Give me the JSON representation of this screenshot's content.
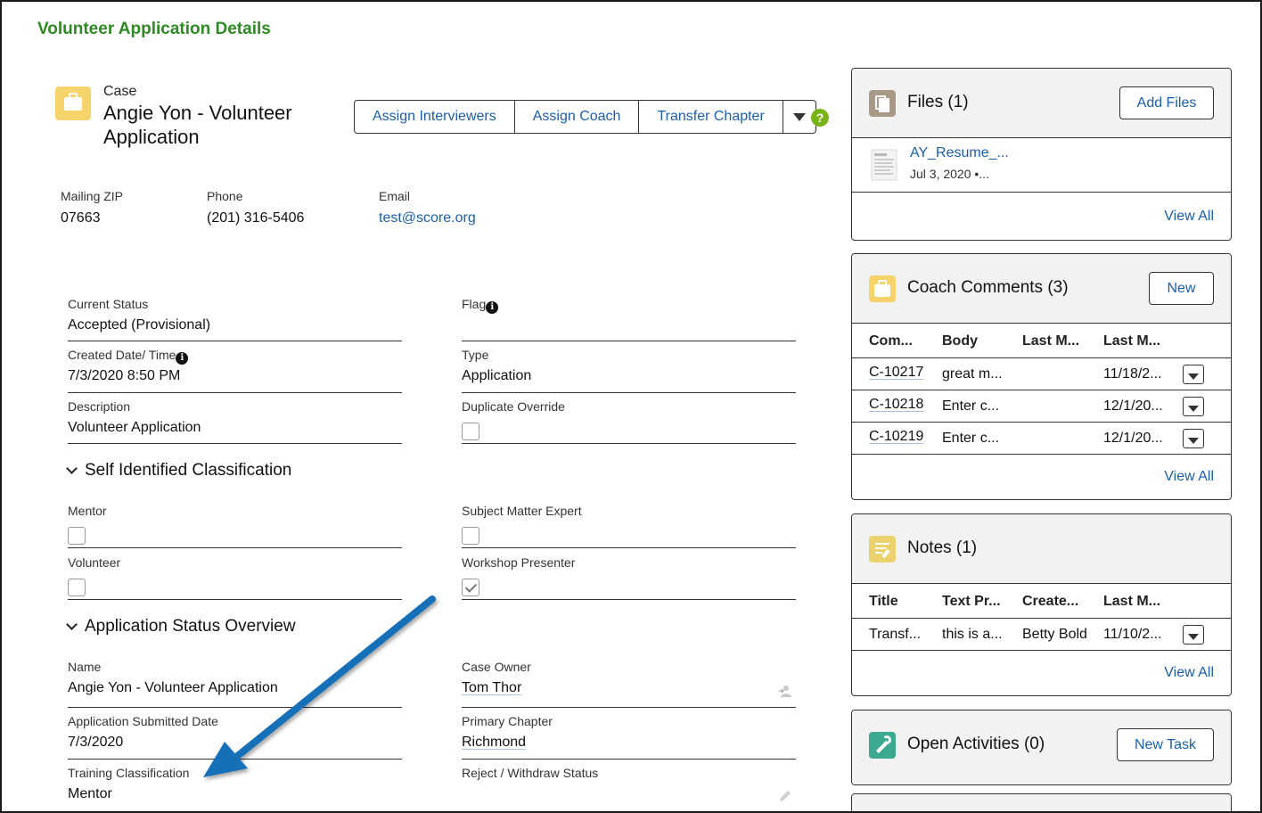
{
  "page": {
    "heading": "Volunteer Application Details"
  },
  "record": {
    "type": "Case",
    "title": "Angie Yon - Volunteer Application",
    "actions": [
      "Assign Interviewers",
      "Assign Coach",
      "Transfer Chapter"
    ],
    "help_symbol": "?"
  },
  "highlights": {
    "zip_label": "Mailing ZIP",
    "zip": "07663",
    "phone_label": "Phone",
    "phone": "(201) 316-5406",
    "email_label": "Email",
    "email": "test@score.org"
  },
  "details": {
    "current_status_label": "Current Status",
    "current_status": "Accepted (Provisional)",
    "flag_label": "Flag",
    "created_label": "Created Date/ Time",
    "created": "7/3/2020 8:50 PM",
    "type_label": "Type",
    "type": "Application",
    "description_label": "Description",
    "description": "Volunteer Application",
    "dup_label": "Duplicate Override"
  },
  "self_identified": {
    "heading": "Self Identified Classification",
    "mentor_label": "Mentor",
    "sme_label": "Subject Matter Expert",
    "volunteer_label": "Volunteer",
    "workshop_label": "Workshop Presenter",
    "workshop_checked": true
  },
  "status_overview": {
    "heading": "Application Status Overview",
    "name_label": "Name",
    "name": "Angie Yon - Volunteer Application",
    "owner_label": "Case Owner",
    "owner": "Tom Thor",
    "submitted_label": "Application Submitted Date",
    "submitted": "7/3/2020",
    "chapter_label": "Primary Chapter",
    "chapter": "Richmond",
    "training_label": "Training Classification",
    "training": "Mentor",
    "reject_label": "Reject / Withdraw Status"
  },
  "files_card": {
    "title": "Files (1)",
    "button": "Add Files",
    "file_name": "AY_Resume_...",
    "file_meta": "Jul 3, 2020 •...",
    "view_all": "View All"
  },
  "coach_card": {
    "title": "Coach Comments (3)",
    "button": "New",
    "columns": [
      "Com...",
      "Body",
      "Last M...",
      "Last M..."
    ],
    "rows": [
      {
        "id": "C-10217",
        "body": "great m...",
        "last_mod_by": "",
        "last_mod": "11/18/2..."
      },
      {
        "id": "C-10218",
        "body": "Enter c...",
        "last_mod_by": "",
        "last_mod": "12/1/20..."
      },
      {
        "id": "C-10219",
        "body": "Enter c...",
        "last_mod_by": "",
        "last_mod": "12/1/20..."
      }
    ],
    "view_all": "View All"
  },
  "notes_card": {
    "title": "Notes (1)",
    "columns": [
      "Title",
      "Text Pr...",
      "Create...",
      "Last M..."
    ],
    "rows": [
      {
        "title": "Transf...",
        "text": "this is a...",
        "created_by": "Betty Bold",
        "last_mod": "11/10/2..."
      }
    ],
    "view_all": "View All"
  },
  "activities_card": {
    "title": "Open Activities (0)",
    "button": "New Task"
  },
  "colors": {
    "heading_green": "#2e8a22",
    "link_blue": "#1b5fa8",
    "arrow_blue": "#1670b8",
    "case_yellow": "#f7d46b"
  }
}
